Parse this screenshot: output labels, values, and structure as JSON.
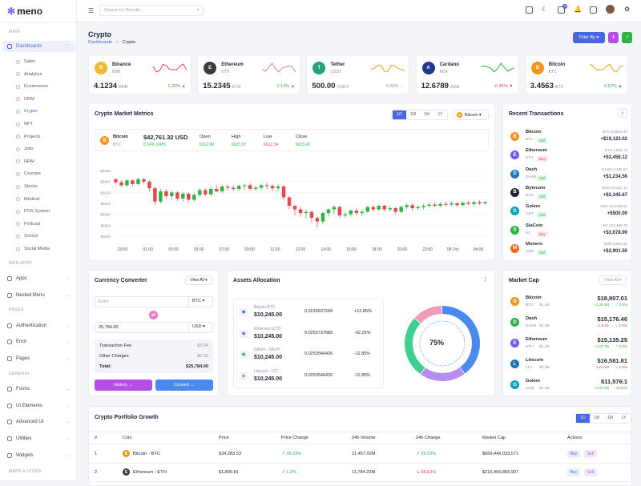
{
  "app": {
    "logo": "meno"
  },
  "search": {
    "placeholder": "Search for Results..."
  },
  "topbar": {
    "cart_badge": "4"
  },
  "sidebar": {
    "sections": [
      {
        "label": "MAIN",
        "y": 37
      },
      {
        "label": "WEB APPS",
        "y": 326
      },
      {
        "label": "PAGES",
        "y": 384
      },
      {
        "label": "GENERAL",
        "y": 464
      },
      {
        "label": "MAPS & ICONS",
        "y": 586
      }
    ],
    "menus": [
      {
        "label": "Dashboards",
        "y": 51,
        "active": true,
        "name": "menu-dashboards"
      },
      {
        "label": "Apps",
        "y": 341,
        "name": "menu-apps"
      },
      {
        "label": "Nested Menu",
        "y": 362,
        "name": "menu-nested"
      },
      {
        "label": "Authentication",
        "y": 400,
        "name": "menu-authentication"
      },
      {
        "label": "Error",
        "y": 420,
        "name": "menu-error"
      },
      {
        "label": "Pages",
        "y": 441,
        "name": "menu-pages"
      },
      {
        "label": "Forms",
        "y": 479,
        "name": "menu-forms"
      },
      {
        "label": "UI Elements",
        "y": 500,
        "name": "menu-ui-elements"
      },
      {
        "label": "Advanced UI",
        "y": 520,
        "name": "menu-advanced-ui"
      },
      {
        "label": "Utilities",
        "y": 541,
        "name": "menu-utilities"
      },
      {
        "label": "Widgets",
        "y": 562,
        "name": "menu-widgets"
      }
    ],
    "sub": [
      "Sales",
      "Analytics",
      "Ecommerce",
      "CRM",
      "Crypto",
      "NFT",
      "Projects",
      "Jobs",
      "HRM",
      "Courses",
      "Stocks",
      "Medical",
      "POS System",
      "Podcast",
      "School",
      "Social Media"
    ],
    "sub_active": "Crypto"
  },
  "page": {
    "title": "Crypto",
    "crumb_parent": "Dashboards",
    "crumb_sep": ">",
    "crumb_current": "Crypto",
    "filter_label": "Filter By"
  },
  "tickers": [
    {
      "name": "Binance",
      "sym": "BNB",
      "value": "4.1234",
      "unit": "BNB",
      "pct": "1.32%",
      "dir": "up",
      "color": "#f3ba2f",
      "letter": "B",
      "line": "#e5484d"
    },
    {
      "name": "Ethereum",
      "sym": "ETH",
      "value": "15.2345",
      "unit": "ETH",
      "pct": "2.14%",
      "dir": "up",
      "color": "#3c3c3d",
      "letter": "E",
      "line": "#e879a6"
    },
    {
      "name": "Tether",
      "sym": "USDT",
      "value": "500.00",
      "unit": "USDT",
      "pct": "0.00%",
      "dir": "flat",
      "color": "#26a17b",
      "letter": "T",
      "line": "#f39c12"
    },
    {
      "name": "Cardano",
      "sym": "ADA",
      "value": "12.6789",
      "unit": "ADA",
      "pct": "-0.45%",
      "dir": "down",
      "color": "#1e3a8a",
      "letter": "A",
      "line": "#2fb344"
    },
    {
      "name": "Bitcoin",
      "sym": "BTC",
      "value": "3.4563",
      "unit": "BTC",
      "pct": "0.57%",
      "dir": "up",
      "color": "#f7931a",
      "letter": "B",
      "line": "#f39c12"
    }
  ],
  "metrics": {
    "title": "Crypto Market Metrics",
    "tabs": [
      "1D",
      "1W",
      "1M",
      "1Y"
    ],
    "active_tab": "1D",
    "select": "Bitcoin",
    "coin": "Bitcoin",
    "sym": "BTC",
    "price": "$42,761.32 USD",
    "change": "0.14% (24H)",
    "stats": [
      {
        "label": "Open",
        "value": "6612.98",
        "cls": "g"
      },
      {
        "label": "High",
        "value": "6625.97",
        "cls": "g"
      },
      {
        "label": "Low",
        "value": "6612.34",
        "cls": "r"
      },
      {
        "label": "Close",
        "value": "6623.45",
        "cls": "g"
      }
    ]
  },
  "chart_data": {
    "type": "candlestick",
    "y_ticks": [
      "$6660",
      "$6640",
      "$6620",
      "$6600",
      "$6580",
      "$6560",
      "$6540"
    ],
    "x_ticks": [
      "23:00",
      "01:00",
      "03:00",
      "05:00",
      "07:00",
      "09:00",
      "11:00",
      "12:00",
      "14:00",
      "16:00",
      "18:00",
      "20:00",
      "22:00",
      "08 Oct",
      "04:00"
    ],
    "ylim": [
      6535,
      6665
    ],
    "candles": [
      [
        6640,
        6635,
        6642,
        6632
      ],
      [
        6635,
        6630,
        6638,
        6627
      ],
      [
        6630,
        6638,
        6640,
        6628
      ],
      [
        6638,
        6632,
        6640,
        6628
      ],
      [
        6632,
        6640,
        6643,
        6630
      ],
      [
        6640,
        6636,
        6642,
        6633
      ],
      [
        6636,
        6625,
        6638,
        6620
      ],
      [
        6625,
        6603,
        6628,
        6598
      ],
      [
        6603,
        6620,
        6624,
        6600
      ],
      [
        6620,
        6612,
        6623,
        6608
      ],
      [
        6612,
        6618,
        6621,
        6606
      ],
      [
        6618,
        6608,
        6620,
        6604
      ],
      [
        6608,
        6616,
        6619,
        6603
      ],
      [
        6616,
        6606,
        6618,
        6602
      ],
      [
        6606,
        6614,
        6617,
        6603
      ],
      [
        6614,
        6622,
        6625,
        6611
      ],
      [
        6622,
        6615,
        6625,
        6612
      ],
      [
        6615,
        6624,
        6628,
        6612
      ],
      [
        6624,
        6620,
        6630,
        6618
      ],
      [
        6620,
        6628,
        6631,
        6617
      ],
      [
        6628,
        6626,
        6631,
        6622
      ],
      [
        6626,
        6624,
        6630,
        6620
      ],
      [
        6624,
        6629,
        6632,
        6621
      ],
      [
        6629,
        6630,
        6632,
        6623
      ],
      [
        6630,
        6624,
        6634,
        6621
      ],
      [
        6624,
        6626,
        6630,
        6620
      ],
      [
        6626,
        6630,
        6633,
        6622
      ],
      [
        6630,
        6629,
        6634,
        6624
      ],
      [
        6629,
        6625,
        6632,
        6620
      ],
      [
        6625,
        6628,
        6632,
        6620
      ],
      [
        6628,
        6610,
        6630,
        6605
      ],
      [
        6610,
        6596,
        6612,
        6590
      ],
      [
        6596,
        6590,
        6598,
        6580
      ],
      [
        6590,
        6584,
        6594,
        6578
      ],
      [
        6584,
        6586,
        6590,
        6575
      ],
      [
        6586,
        6576,
        6588,
        6568
      ],
      [
        6576,
        6570,
        6578,
        6560
      ],
      [
        6570,
        6584,
        6587,
        6565
      ],
      [
        6584,
        6590,
        6592,
        6578
      ],
      [
        6590,
        6594,
        6596,
        6582
      ],
      [
        6594,
        6580,
        6596,
        6576
      ],
      [
        6580,
        6582,
        6586,
        6576
      ],
      [
        6582,
        6588,
        6590,
        6578
      ],
      [
        6588,
        6584,
        6592,
        6580
      ],
      [
        6584,
        6586,
        6590,
        6580
      ],
      [
        6586,
        6594,
        6596,
        6584
      ],
      [
        6594,
        6590,
        6597,
        6586
      ],
      [
        6590,
        6596,
        6598,
        6587
      ],
      [
        6596,
        6590,
        6598,
        6586
      ],
      [
        6590,
        6592,
        6595,
        6586
      ],
      [
        6592,
        6586,
        6594,
        6582
      ],
      [
        6586,
        6594,
        6597,
        6584
      ],
      [
        6594,
        6597,
        6600,
        6590
      ],
      [
        6597,
        6592,
        6600,
        6588
      ],
      [
        6592,
        6594,
        6597,
        6589
      ],
      [
        6594,
        6596,
        6599,
        6590
      ],
      [
        6596,
        6598,
        6601,
        6593
      ],
      [
        6598,
        6596,
        6602,
        6594
      ],
      [
        6596,
        6599,
        6602,
        6594
      ],
      [
        6599,
        6598,
        6603,
        6595
      ],
      [
        6598,
        6600,
        6603,
        6596
      ],
      [
        6600,
        6597,
        6602,
        6594
      ],
      [
        6597,
        6601,
        6603,
        6595
      ],
      [
        6601,
        6599,
        6604,
        6597
      ],
      [
        6599,
        6602,
        6604,
        6596
      ],
      [
        6602,
        6600,
        6605,
        6597
      ],
      [
        6600,
        6602,
        6604,
        6598
      ]
    ]
  },
  "transactions": {
    "title": "Recent Transactions",
    "items": [
      {
        "name": "Bitcoin",
        "sym": "BTC",
        "tag": "Sell",
        "amt": "BTC 0.0823.45",
        "usd": "+$19,123.02",
        "color": "#f7931a",
        "letter": "B"
      },
      {
        "name": "Ethereum",
        "sym": "ETH",
        "tag": "Buy",
        "amt": "ETH 1.532.75",
        "usd": "+$3,456.12",
        "color": "#6f5cf5",
        "letter": "E"
      },
      {
        "name": "Dash",
        "sym": "DASH",
        "tag": "Sell",
        "amt": "DASH 2.345.67",
        "usd": "+$1,234.56",
        "color": "#1c75bc",
        "letter": "D"
      },
      {
        "name": "Bytecoin",
        "sym": "BCN",
        "tag": "Sell",
        "amt": "BCN 10.432.12",
        "usd": "+$2,345.67",
        "color": "#1f2433",
        "letter": "B"
      },
      {
        "name": "Golem",
        "sym": "GNT",
        "tag": "Sell",
        "amt": "GNT 15.6789.01",
        "usd": "+$500.00",
        "color": "#00a2b9",
        "letter": "G"
      },
      {
        "name": "SiaCoin",
        "sym": "SC",
        "tag": "Buy",
        "amt": "SC 123.456.78",
        "usd": "+$3,678.90",
        "color": "#2fb344",
        "letter": "S"
      },
      {
        "name": "Monero",
        "sym": "XMR",
        "tag": "Sell",
        "amt": "XMR 5.654.32",
        "usd": "+$2,901.50",
        "color": "#f26822",
        "letter": "M"
      }
    ]
  },
  "converter": {
    "title": "Currency Converter",
    "view": "View All",
    "enter_placeholder": "Enter",
    "from": "BTC",
    "amount": "25,784.00",
    "to": "USD",
    "fee_label": "Transaction Fee",
    "fee": "$3.04",
    "other_label": "Other Charges",
    "other": "$6.55",
    "total_label": "Total:",
    "total": "$25,784.00",
    "history": "History",
    "convert": "Convert"
  },
  "assets": {
    "title": "Assets Allocation",
    "center": "75%",
    "items": [
      {
        "name": "Bitcoin BTC",
        "value": "$10,245.00",
        "qty": "0.0215637249",
        "pct": "+12.85%",
        "color": "#4a67e3"
      },
      {
        "name": "Ethereum ETH",
        "value": "$10,245.00",
        "qty": "0.0253737689",
        "pct": "-02.25%",
        "color": "#8b5cf6"
      },
      {
        "name": "DASH - DASH",
        "value": "$10,245.00",
        "qty": "0.0253546426",
        "pct": "-11.85%",
        "color": "#2fb344"
      },
      {
        "name": "Litecoin - LTC",
        "value": "$10,245.00",
        "qty": "0.0253546426",
        "pct": "-11.85%",
        "color": "#9aa0ad"
      }
    ],
    "donut": [
      {
        "value": 40,
        "color": "#4a8af0"
      },
      {
        "value": 20,
        "color": "#b68cf2"
      },
      {
        "value": 27,
        "color": "#3fcf8e"
      },
      {
        "value": 13,
        "color": "#f39bbb"
      }
    ]
  },
  "marketcap": {
    "title": "Market Cap",
    "view": "View All",
    "items": [
      {
        "name": "Bitcoin",
        "sym": "BTC",
        "cap": "$1.1B",
        "price": "$18,907.01",
        "a": "+1,30.90",
        "b": "2.9%",
        "cls": "g",
        "color": "#f7931a",
        "letter": "B"
      },
      {
        "name": "Dash",
        "sym": "DASH",
        "cap": "$2.3B",
        "price": "$15,176.46",
        "a": "-1.8.01",
        "b": "4.6%",
        "cls": "r",
        "color": "#2fb344",
        "letter": "D"
      },
      {
        "name": "Ethereum",
        "sym": "ETH",
        "cap": "$1.1B",
        "price": "$15,135.25",
        "a": "+1,07.05",
        "b": "2.0%",
        "cls": "g",
        "color": "#6f5cf5",
        "letter": "E"
      },
      {
        "name": "Litecoin",
        "sym": "LTC",
        "cap": "$2.3B",
        "price": "$16,581.81",
        "a": "-1,01.05",
        "b": "6.6%",
        "cls": "r",
        "color": "#1c75bc",
        "letter": "L"
      },
      {
        "name": "Golem",
        "sym": "GLM",
        "cap": "$2.2B",
        "price": "$11,576.1",
        "a": "+1,67.06",
        "b": "0.02%",
        "cls": "g",
        "color": "#00a2b9",
        "letter": "G"
      }
    ]
  },
  "portfolio": {
    "title": "Crypto Portfolio Growth",
    "tabs": [
      "1D",
      "1W",
      "1M",
      "1Y"
    ],
    "headers": [
      "#",
      "Coin",
      "Price",
      "Price Change",
      "24h Volume",
      "24h Change",
      "Market Cap",
      "Actions"
    ],
    "rows": [
      {
        "n": "1",
        "coin": "Bitcoin - BTC",
        "price": "$34,283.53",
        "change": "39.23%",
        "vol": "21,457.02M",
        "c24": "39.23%",
        "cap": "$669,449,033,571",
        "color": "#f7931a",
        "letter": "B"
      },
      {
        "n": "2",
        "coin": "Ethereum - ETH",
        "price": "$1,800.81",
        "change": "1.2%",
        "vol": "11,784.22M",
        "c24": "58.63%",
        "cap": "$216,466,869,907",
        "color": "#3c3c3d",
        "letter": "E"
      }
    ],
    "buy": "Buy",
    "sell": "Sell"
  }
}
